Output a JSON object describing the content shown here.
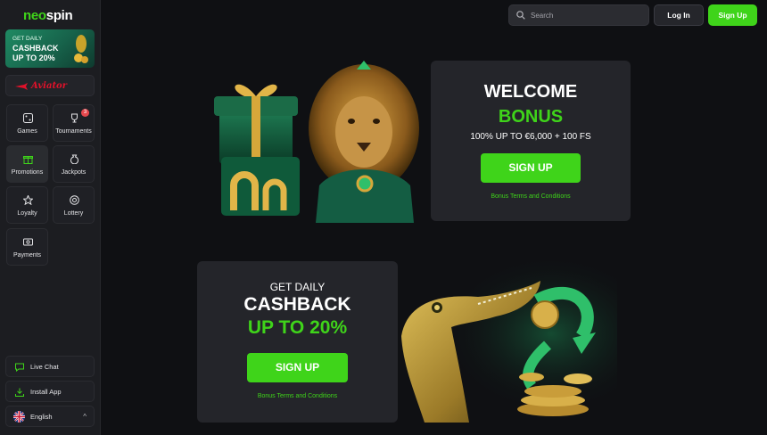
{
  "brand": {
    "neo": "neo",
    "spin": "spin"
  },
  "sidebar": {
    "promo": {
      "line1": "GET DAILY",
      "line2": "CASHBACK",
      "line3": "UP TO 20%"
    },
    "aviator": "Aviator",
    "nav": [
      {
        "label": "Games",
        "icon": "dice-icon"
      },
      {
        "label": "Tournaments",
        "icon": "trophy-icon",
        "badge": "3"
      },
      {
        "label": "Promotions",
        "icon": "gift-icon",
        "active": true
      },
      {
        "label": "Jackpots",
        "icon": "money-bag-icon"
      },
      {
        "label": "Loyalty",
        "icon": "star-icon"
      },
      {
        "label": "Lottery",
        "icon": "lottery-icon"
      },
      {
        "label": "Payments",
        "icon": "payments-icon"
      }
    ],
    "live_chat": "Live Chat",
    "install_app": "Install App",
    "language": "English"
  },
  "header": {
    "search_placeholder": "Search",
    "login": "Log In",
    "signup": "Sign Up"
  },
  "welcome_card": {
    "title": "WELCOME",
    "subtitle": "BONUS",
    "offer": "100% UP TO €6,000 + 100 FS",
    "cta": "SIGN UP",
    "terms": "Bonus Terms and Conditions"
  },
  "cashback_card": {
    "line1": "GET DAILY",
    "line2": "CASHBACK",
    "line3": "UP TO 20%",
    "cta": "SIGN UP",
    "terms": "Bonus Terms and Conditions"
  },
  "colors": {
    "accent": "#3fd41a",
    "panel": "#24252a",
    "background": "#0f1013"
  }
}
